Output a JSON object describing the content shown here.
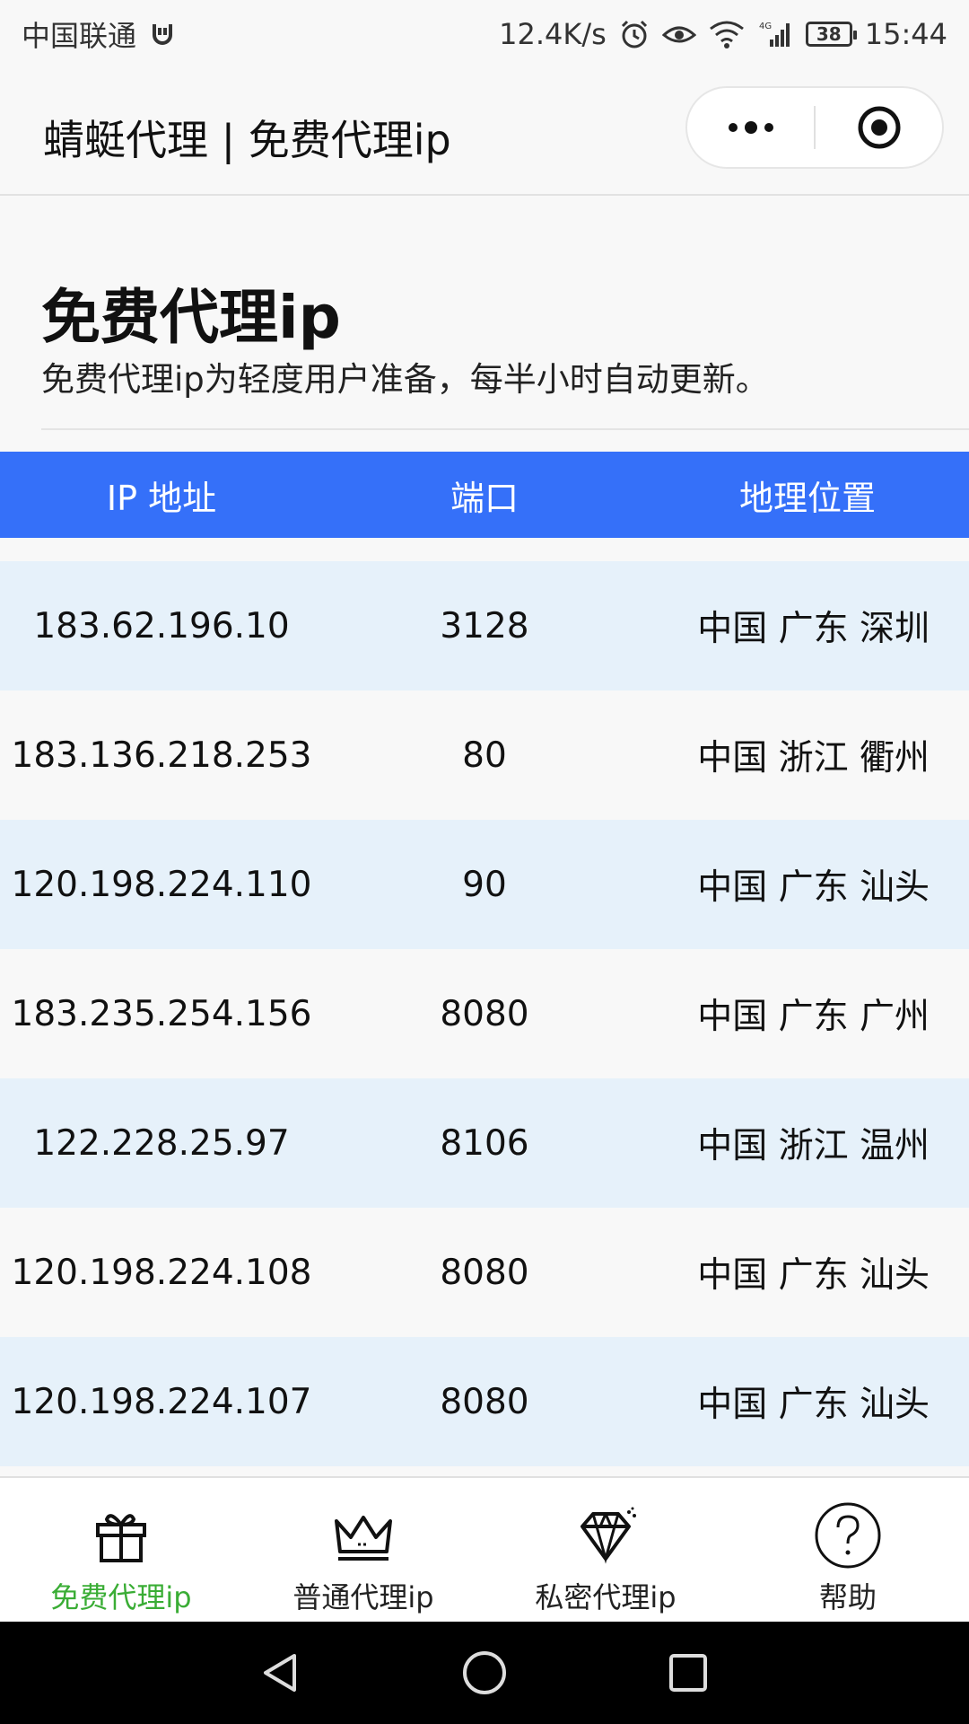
{
  "status_bar": {
    "carrier": "中国联通",
    "speed": "12.4K/s",
    "network": "4G",
    "battery": "38",
    "time": "15:44"
  },
  "title_bar": {
    "title": "蜻蜓代理 | 免费代理ip"
  },
  "header": {
    "heading": "免费代理ip",
    "subtitle": "免费代理ip为轻度用户准备，每半小时自动更新。"
  },
  "table": {
    "columns": [
      "IP 地址",
      "端口",
      "地理位置"
    ],
    "rows": [
      {
        "ip": "183.62.196.10",
        "port": "3128",
        "location": "中国 广东 深圳"
      },
      {
        "ip": "183.136.218.253",
        "port": "80",
        "location": "中国 浙江 衢州"
      },
      {
        "ip": "120.198.224.110",
        "port": "90",
        "location": "中国 广东 汕头"
      },
      {
        "ip": "183.235.254.156",
        "port": "8080",
        "location": "中国 广东 广州"
      },
      {
        "ip": "122.228.25.97",
        "port": "8106",
        "location": "中国 浙江 温州"
      },
      {
        "ip": "120.198.224.108",
        "port": "8080",
        "location": "中国 广东 汕头"
      },
      {
        "ip": "120.198.224.107",
        "port": "8080",
        "location": "中国 广东 汕头"
      }
    ]
  },
  "tab_bar": {
    "tabs": [
      {
        "label": "免费代理ip",
        "icon": "gift-icon",
        "active": true
      },
      {
        "label": "普通代理ip",
        "icon": "crown-icon",
        "active": false
      },
      {
        "label": "私密代理ip",
        "icon": "diamond-icon",
        "active": false
      },
      {
        "label": "帮助",
        "icon": "help-icon",
        "active": false
      }
    ]
  },
  "colors": {
    "accent_blue": "#3570f9",
    "row_stripe": "#e6f1fa",
    "active_tab": "#3aad35"
  }
}
